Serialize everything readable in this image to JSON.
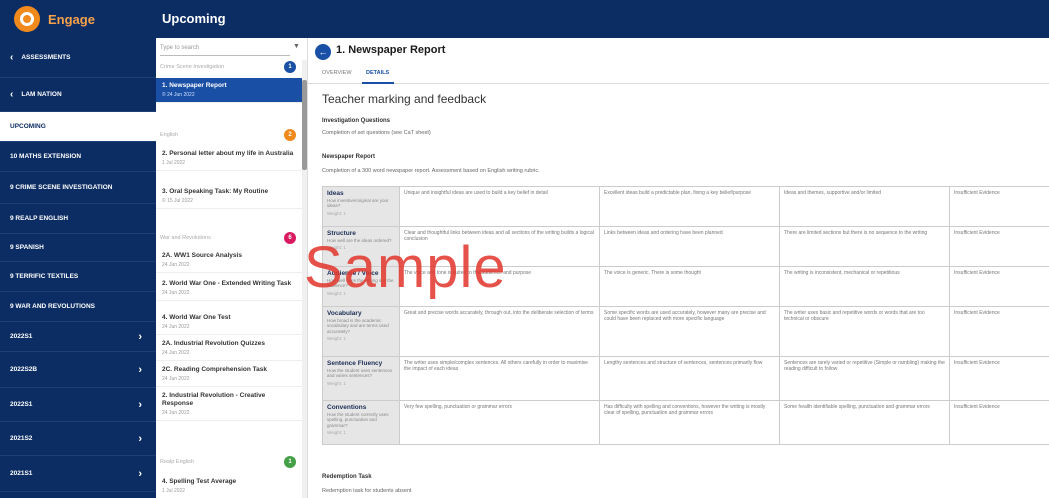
{
  "app": {
    "name": "Engage",
    "header_title": "Upcoming"
  },
  "sidebar": {
    "items": [
      {
        "label": "Assessments",
        "back": true,
        "active": false,
        "chevron": false
      },
      {
        "label": "Lam Nation",
        "back": true,
        "active": false,
        "chevron": false
      },
      {
        "label": "Upcoming",
        "back": false,
        "active": true,
        "chevron": false
      },
      {
        "label": "10 Maths Extension",
        "back": false,
        "active": false,
        "chevron": false
      },
      {
        "label": "9 Crime Scene Investigation",
        "back": false,
        "active": false,
        "chevron": false
      },
      {
        "label": "9 Realp English",
        "back": false,
        "active": false,
        "chevron": false
      },
      {
        "label": "9 Spanish",
        "back": false,
        "active": false,
        "chevron": false
      },
      {
        "label": "9 Terrific Textiles",
        "back": false,
        "active": false,
        "chevron": false
      },
      {
        "label": "9 War and Revolutions",
        "back": false,
        "active": false,
        "chevron": false
      },
      {
        "label": "2022S1",
        "back": false,
        "active": false,
        "chevron": true
      },
      {
        "label": "2022S2B",
        "back": false,
        "active": false,
        "chevron": true
      },
      {
        "label": "2022S1",
        "back": false,
        "active": false,
        "chevron": true
      },
      {
        "label": "2021S2",
        "back": false,
        "active": false,
        "chevron": true
      },
      {
        "label": "2021S1",
        "back": false,
        "active": false,
        "chevron": true
      }
    ]
  },
  "middle": {
    "search_placeholder": "Type to search",
    "groups": [
      {
        "label": "Crime Scene Investigation",
        "badge": "1",
        "badge_color": "#1a4fa6"
      },
      {
        "label": "English",
        "badge": "2",
        "badge_color": "#f08a1c"
      },
      {
        "label": "War and Revolutions",
        "badge": "6",
        "badge_color": "#d81b60"
      },
      {
        "label": "Realp English",
        "badge": "1",
        "badge_color": "#43a047"
      }
    ],
    "items": [
      {
        "title": "1. Newspaper Report",
        "date": "© 24 Jun 2022",
        "selected": true
      },
      {
        "title": "2. Personal letter about my life in Australia",
        "date": "1 Jul 2022",
        "selected": false
      },
      {
        "title": "3. Oral Speaking Task: My Routine",
        "date": "© 15 Jul 2022",
        "selected": false
      },
      {
        "title": "2A. WW1 Source Analysis",
        "date": "24 Jun 2022",
        "selected": false
      },
      {
        "title": "2. World War One - Extended Writing Task",
        "date": "24 Jun 2022",
        "selected": false
      },
      {
        "title": "4. World War One Test",
        "date": "24 Jun 2022",
        "selected": false
      },
      {
        "title": "2A. Industrial Revolution Quizzes",
        "date": "24 Jun 2022",
        "selected": false
      },
      {
        "title": "2C. Reading Comprehension Task",
        "date": "24 Jun 2022",
        "selected": false
      },
      {
        "title": "2. Industrial Revolution - Creative Response",
        "date": "24 Jun 2022",
        "selected": false
      },
      {
        "title": "4. Spelling Test Average",
        "date": "1 Jul 2022",
        "selected": false
      }
    ]
  },
  "main": {
    "title": "1. Newspaper Report",
    "tabs": [
      "Overview",
      "Details"
    ],
    "active_tab": "Details",
    "section_title": "Teacher marking and feedback",
    "investigation_head": "Investigation Questions",
    "investigation_text": "Completion of set questions (see CaT sheet)",
    "newspaper_head": "Newspaper Report",
    "newspaper_text": "Completion of a 300 word newspaper report. Assessment based on English writing rubric.",
    "redemption_head": "Redemption Task",
    "redemption_text": "Redemption task for students absent",
    "rubric": [
      {
        "name": "Ideas",
        "question": "How inventive/original are your ideas?",
        "weight": "Weight: 1",
        "c1": "Unique and insightful ideas are used to build a key belief in detail",
        "c2": "Excellent ideas build a predictable plan, fixing a key belief/purpose",
        "c3": "Ideas and themes, supportive and/or limited",
        "c4": "Insufficient Evidence"
      },
      {
        "name": "Structure",
        "question": "How well are the ideas ordered?",
        "weight": "Weight: 1",
        "c1": "Clear and thoughtful links between ideas and all sections of the writing builds a logical conclusion",
        "c2": "Links between ideas and ordering have been planned",
        "c3": "There are limited sections but there is no sequence to the writing",
        "c4": "Insufficient Evidence"
      },
      {
        "name": "Audience / Voice",
        "question": "How well does the writing suit the audience?",
        "weight": "Weight: 1",
        "c1": "The voice and tone is suited to the audience and purpose",
        "c2": "The voice is generic. There is some thought",
        "c3": "The writing is inconsistent, mechanical or repetitious",
        "c4": "Insufficient Evidence"
      },
      {
        "name": "Vocabulary",
        "question": "How broad is the academic vocabulary and are terms used accurately?",
        "weight": "Weight: 1",
        "c1": "Great and precise words accurately, through out, into the deliberate selection of terms",
        "c2": "Some specific words are used accurately, however many are precise and could have been replaced with more specific language",
        "c3": "The writer uses basic and repetitive words or words that are too technical or obscure",
        "c4": "Insufficient Evidence"
      },
      {
        "name": "Sentence Fluency",
        "question": "How the student uses sentences and varies sentences?",
        "weight": "Weight: 1",
        "c1": "The writer uses simple/complex sentences. All others carefully in order to maximise the impact of each ideas",
        "c2": "Lengthy sentences and structure of sentences, sentences primarily flow",
        "c3": "Sentences are rarely varied or repetitive (Simple or rambling) making the reading difficult to follow",
        "c4": "Insufficient Evidence"
      },
      {
        "name": "Conventions",
        "question": "How the student correctly uses spelling, punctuation and grammar?",
        "weight": "Weight: 1",
        "c1": "Very few spelling, punctuation or grammar errors",
        "c2": "Has difficulty with spelling and conventions, however the writing is mostly clear of spelling, punctuation and grammar errors",
        "c3": "Some health identifiable spelling, punctuation and grammar errors",
        "c4": "Insufficient Evidence"
      }
    ]
  },
  "watermark": "Sample"
}
